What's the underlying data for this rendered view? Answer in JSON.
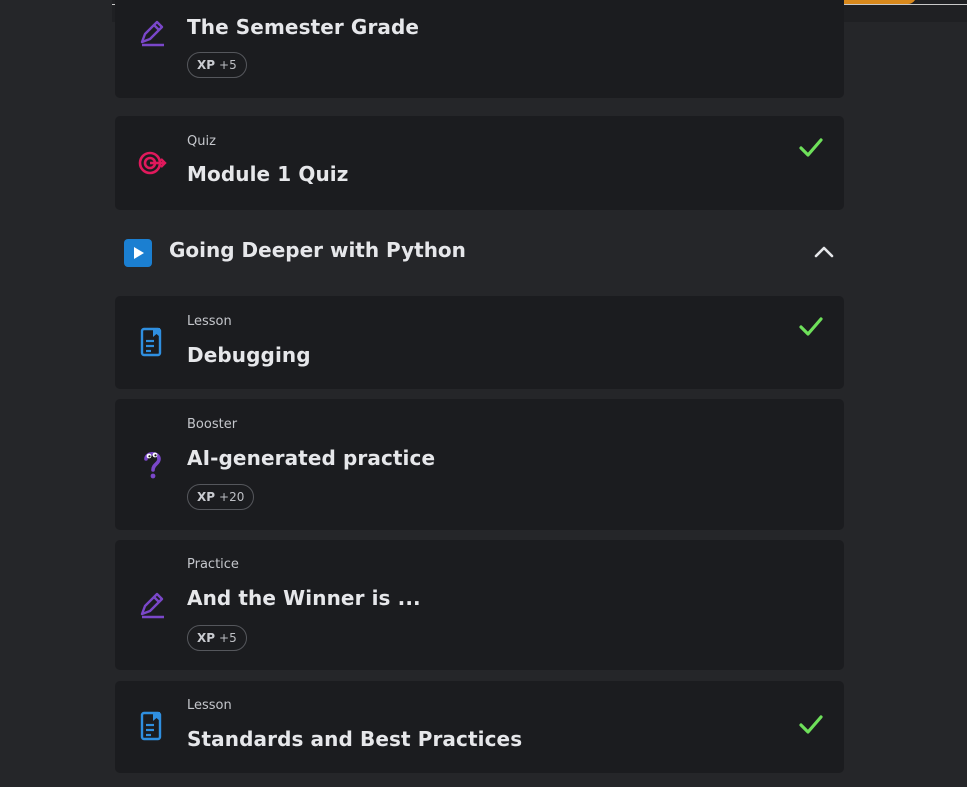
{
  "items_before": [
    {
      "kind": "",
      "title": "The Semester Grade",
      "icon": "pencil-icon",
      "xp_label": "XP",
      "xp_value": "+5",
      "completed": false
    },
    {
      "kind": "Quiz",
      "title": "Module 1 Quiz",
      "icon": "target-icon",
      "completed": true
    }
  ],
  "section": {
    "title": "Going Deeper with Python",
    "icon": "play-icon",
    "expanded": true
  },
  "items_after": [
    {
      "kind": "Lesson",
      "title": "Debugging",
      "icon": "lesson-document-icon",
      "completed": true
    },
    {
      "kind": "Booster",
      "title": "AI-generated practice",
      "icon": "question-mascot-icon",
      "xp_label": "XP",
      "xp_value": "+20",
      "completed": false
    },
    {
      "kind": "Practice",
      "title": "And the Winner is ...",
      "icon": "pencil-icon",
      "xp_label": "XP",
      "xp_value": "+5",
      "completed": false
    },
    {
      "kind": "Lesson",
      "title": "Standards and Best Practices",
      "icon": "lesson-document-icon",
      "completed": true
    }
  ],
  "colors": {
    "background": "#252629",
    "card": "#1b1c1f",
    "check": "#6ee05a",
    "quiz_icon": "#e0195c",
    "lesson_icon": "#2f8fe0",
    "practice_icon": "#7a47c9",
    "section_icon": "#1b7fd1"
  }
}
